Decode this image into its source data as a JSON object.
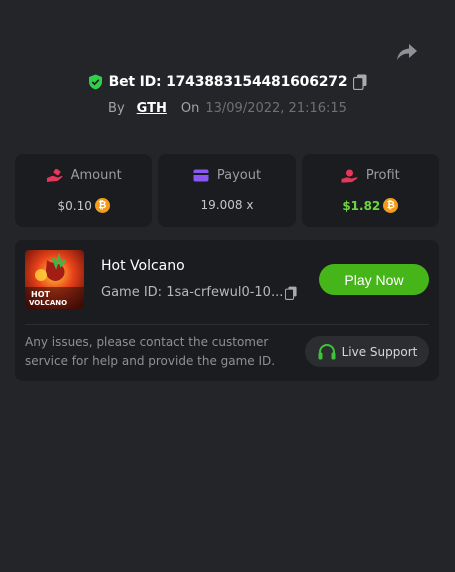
{
  "header": {
    "bet_label": "Bet ID: 1743883154481606272",
    "by_label": "By",
    "user": "GTH",
    "on_label": "On",
    "datetime": "13/09/2022, 21:16:15"
  },
  "stats": [
    {
      "label": "Amount",
      "value": "$0.10",
      "icon": "bet-hand-icon",
      "coin": "bitcoin-coin-icon"
    },
    {
      "label": "Payout",
      "value": "19.008 x",
      "icon": "wallet-card-icon"
    },
    {
      "label": "Profit",
      "value": "$1.82",
      "icon": "profit-hand-icon",
      "coin": "bitcoin-coin-icon"
    }
  ],
  "game": {
    "title": "Hot Volcano",
    "id_text": "Game ID: 1sa-crfewul0-10...",
    "thumb_text_1": "HOT",
    "thumb_text_2": "VOLCANO",
    "play_label": "Play Now",
    "note": "Any issues, please contact the customer service for help and provide the game ID.",
    "support_label": "Live Support"
  },
  "colors": {
    "background": "#232528",
    "card": "#1b1c1f",
    "accent_green": "#46b51a",
    "profit_green": "#6dd63b",
    "coin_orange": "#f39c1b",
    "shield_green": "#2fcf4a"
  }
}
